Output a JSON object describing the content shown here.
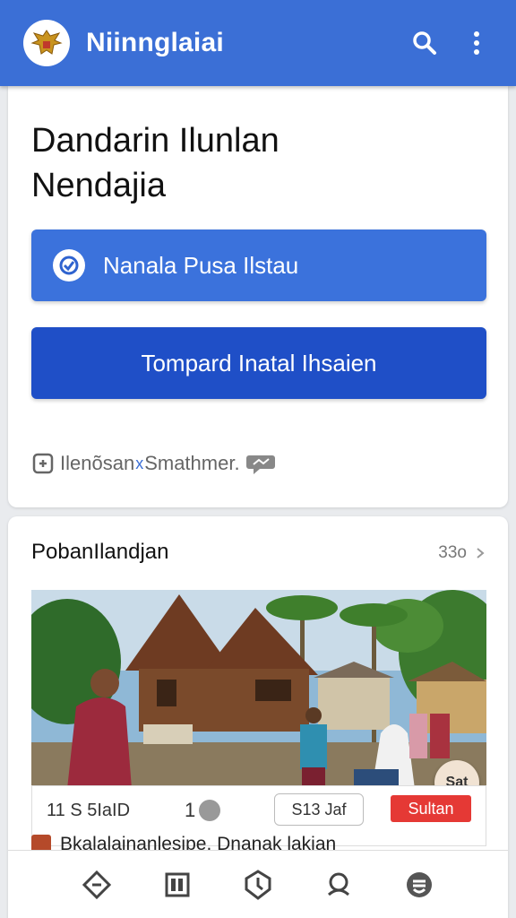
{
  "app": {
    "title": "Niinnglaiai"
  },
  "hero": {
    "headline_line1": "Dandarin Ilunlan",
    "headline_line2": "Nendajia",
    "primary_button": "Nanala Pusa Ilstau",
    "secondary_button": "Tompard Inatal Ihsaien",
    "footer_note": "Ilenõsan",
    "footer_note_sep": "x",
    "footer_note2": "Smathmer."
  },
  "section": {
    "title": "PobanIlandjan",
    "count": "33o",
    "meta": {
      "stat_a": "11 S 5IaID",
      "stat_b": "1",
      "chip_outline": "S13 Jaf",
      "chip_red": "Sultan"
    },
    "fab_label": "Sat",
    "author": "Bkalalainanlesipe. Dnanak lakian"
  },
  "colors": {
    "appbar": "#3b6fd6",
    "primary": "#3b72dc",
    "secondary": "#1f4fc7",
    "badge": "#e53935"
  },
  "icons": {
    "logo": "garuda-emblem-icon",
    "search": "search-icon",
    "menu": "more-vertical-icon",
    "check": "check-circle-icon",
    "nav": [
      "ticket-icon",
      "grid-icon",
      "clock-icon",
      "notification-icon",
      "profile-icon"
    ]
  }
}
